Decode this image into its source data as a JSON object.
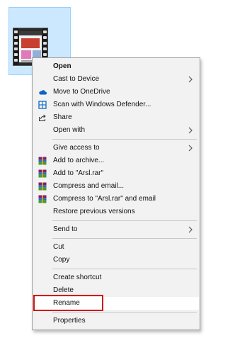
{
  "menu": {
    "items": [
      {
        "label": "Open",
        "bold": true
      },
      {
        "label": "Cast to Device",
        "submenu": true
      },
      {
        "label": "Move to OneDrive",
        "icon": "onedrive-cloud-icon",
        "icon_color": "#0a63c9"
      },
      {
        "label": "Scan with Windows Defender...",
        "icon": "windows-defender-icon",
        "icon_color": "#1e73c8"
      },
      {
        "label": "Share",
        "icon": "share-icon"
      },
      {
        "label": "Open with",
        "submenu": true
      },
      {
        "label": "Give access to",
        "submenu": true
      },
      {
        "label": "Add to archive...",
        "icon": "winrar-icon"
      },
      {
        "label": "Add to \"Arsl.rar\"",
        "icon": "winrar-icon"
      },
      {
        "label": "Compress and email...",
        "icon": "winrar-icon"
      },
      {
        "label": "Compress to \"Arsl.rar\" and email",
        "icon": "winrar-icon"
      },
      {
        "label": "Restore previous versions"
      },
      {
        "label": "Send to",
        "submenu": true
      },
      {
        "label": "Cut"
      },
      {
        "label": "Copy"
      },
      {
        "label": "Create shortcut"
      },
      {
        "label": "Delete"
      },
      {
        "label": "Rename",
        "highlighted": true
      },
      {
        "label": "Properties"
      }
    ]
  },
  "colors": {
    "selection_tile": "#cce8ff",
    "menu_background": "#f2f2f2",
    "rename_callout_border": "#d20e0e"
  }
}
